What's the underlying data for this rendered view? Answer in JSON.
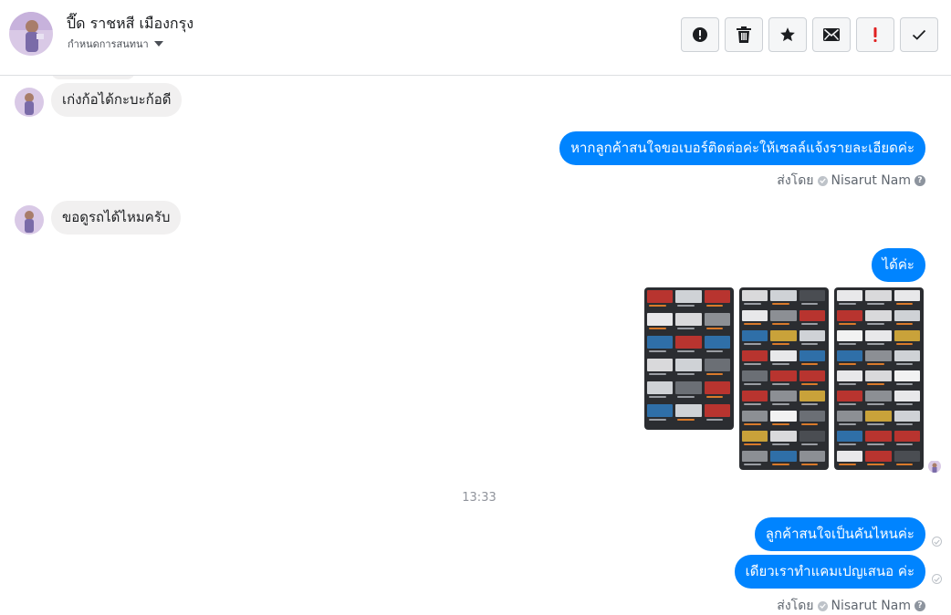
{
  "header": {
    "contact_name": "ปี๊ด ราชหสี เมืองกรุง",
    "subtitle": "กำหนดการสนทนา",
    "actions": [
      {
        "icon": "exclamation-circle-icon"
      },
      {
        "icon": "trash-icon"
      },
      {
        "icon": "star-icon"
      },
      {
        "icon": "envelope-icon"
      },
      {
        "icon": "exclamation-icon",
        "color": "#e02020"
      },
      {
        "icon": "checkmark-icon"
      }
    ]
  },
  "messages": {
    "m1": "เก่งก้อได้กะบะก้อดี",
    "m2": "หากลูกค้าสนใจขอเบอร์ติดต่อค่ะให้เซลล์แจ้งรายละเอียดค่ะ",
    "m3": "ขอดูรถได้ไหมครับ",
    "m4": "ได้ค่ะ",
    "m5": "ลูกค้าสนใจเป็นคันไหนค่ะ",
    "m6": "เดียวเราทำแคมเปญเสนอ ค่ะ"
  },
  "sent_by": {
    "label": "ส่งโดย",
    "agent": "Nisarut Nam"
  },
  "timestamp": "13:33",
  "colors": {
    "outgoing_bubble": "#0084ff",
    "incoming_bubble": "#f1f0f0",
    "photo_bg": "#2b2d31"
  }
}
